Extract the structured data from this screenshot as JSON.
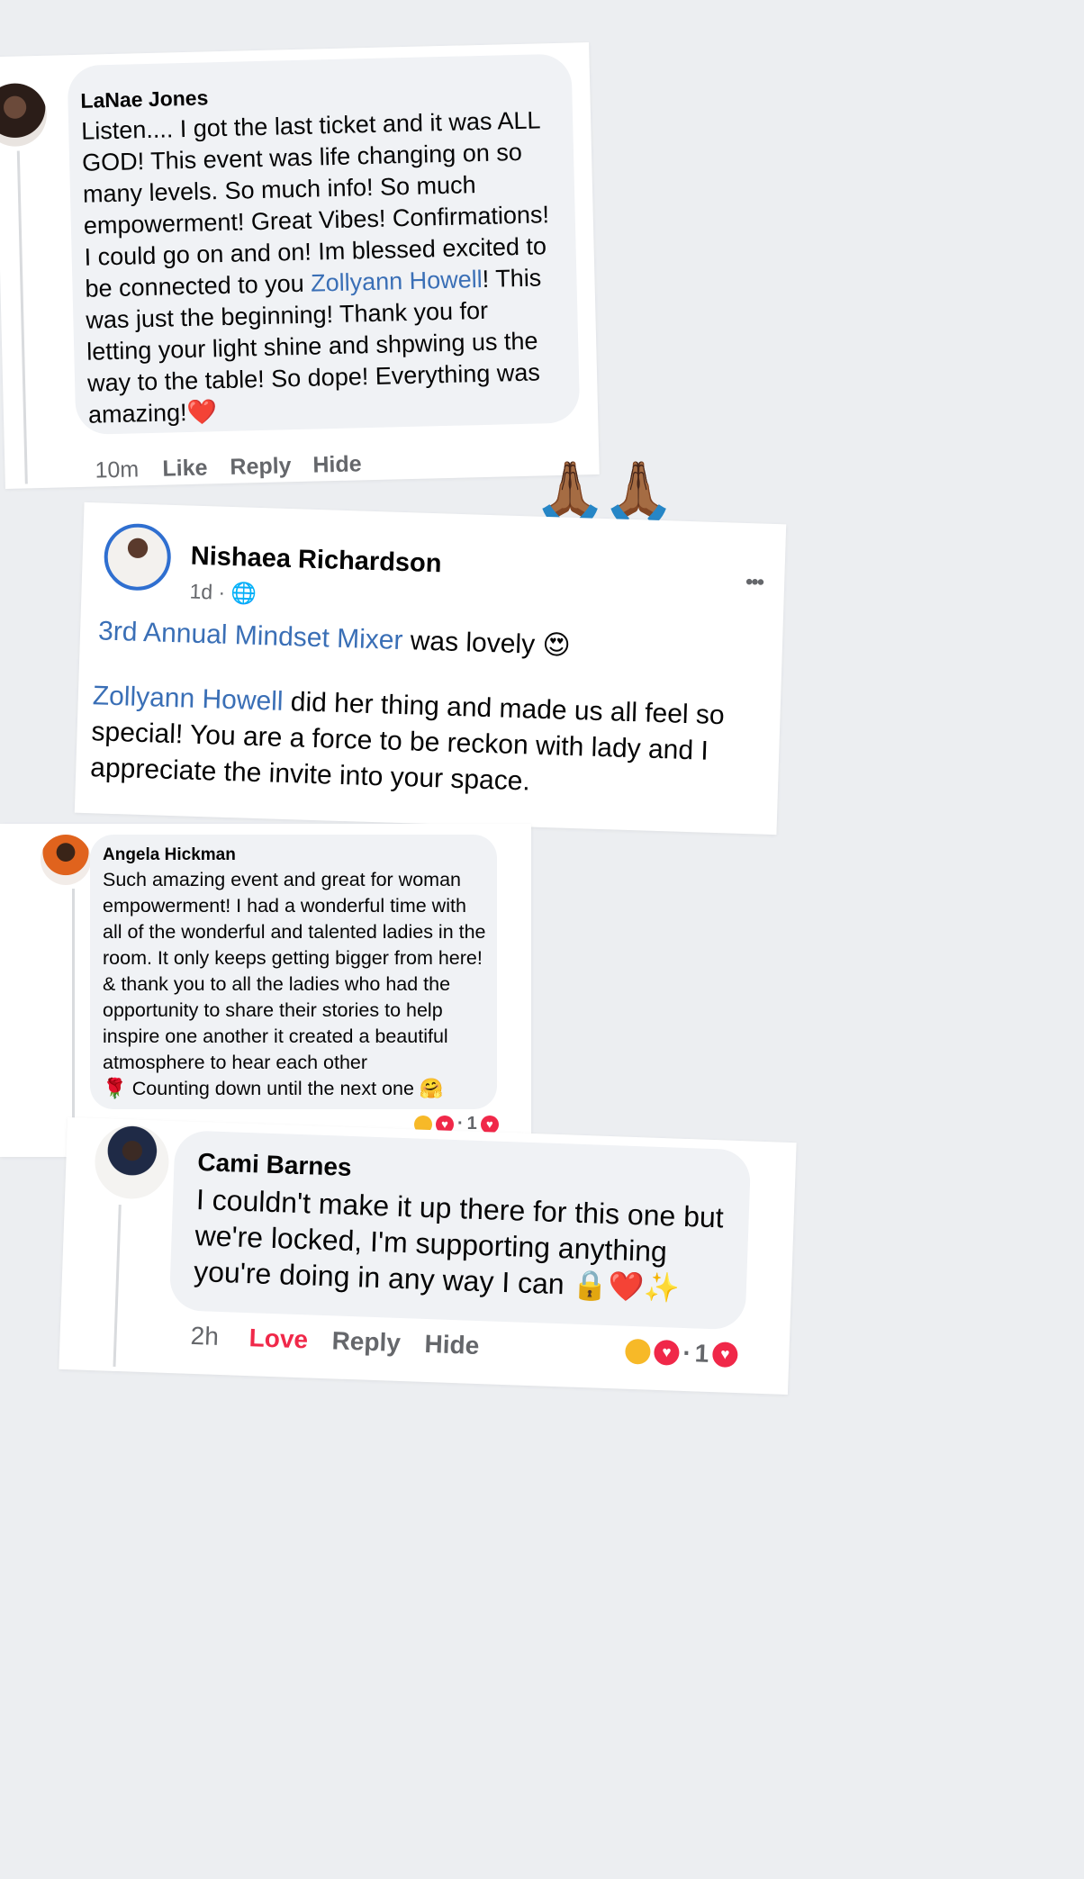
{
  "comment1": {
    "author": "LaNae Jones",
    "text_before_link": "Listen.... I got the last ticket and it was ALL GOD! This event was life changing on so many levels. So much info! So much empowerment! Great Vibes! Confirmations! I could go on and on! Im blessed excited to be connected to you ",
    "link": "Zollyann Howell",
    "text_after_link": "! This was just the beginning! Thank you for letting your light shine and shpwing us the way to the table! So dope! Everything was amazing!",
    "emoji": "❤️",
    "time": "10m",
    "like": "Like",
    "reply": "Reply",
    "hide": "Hide"
  },
  "separator_emoji": "🙏🏾🙏🏾",
  "post": {
    "author": "Nishaea Richardson",
    "time": "1d",
    "privacy_icon": "globe-icon",
    "line1_link": "3rd Annual Mindset Mixer",
    "line1_text": " was lovely ",
    "line1_emoji": "😍",
    "para2_link": "Zollyann Howell",
    "para2_text": "  did her thing and made us all feel so special! You are a force to be reckon with lady and I appreciate the invite into your space.",
    "more": "•••"
  },
  "comment2": {
    "author": "Angela Hickman",
    "text": "Such amazing event and great for woman empowerment! I had a wonderful time with all of the wonderful and talented ladies in the room. It only keeps getting bigger from here! & thank you to all the ladies who had the opportunity to share their stories to help inspire one another it created a beautiful atmosphere to hear each other",
    "rose": "🌹",
    "tail": " Counting down until the next one ",
    "tail_emoji": "🤗",
    "reaction_count": "1"
  },
  "comment3": {
    "author": "Cami Barnes",
    "text": "I couldn't make it up there for this one but we're locked, I'm supporting anything you're doing in any way I can ",
    "emojis": "🔒❤️✨",
    "time": "2h",
    "love": "Love",
    "reply": "Reply",
    "hide": "Hide",
    "reaction_count": "1"
  },
  "colors": {
    "link": "#3a6fb6",
    "love": "#f02849",
    "bubble": "#f0f2f5"
  }
}
